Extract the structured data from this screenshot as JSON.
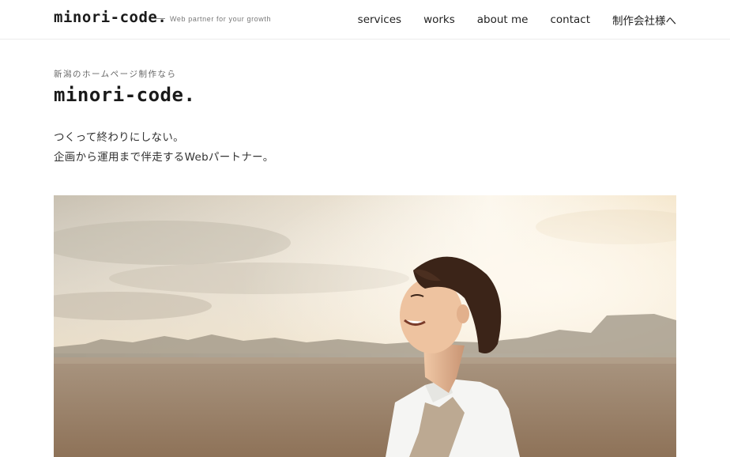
{
  "header": {
    "logo": "minori-code.",
    "tagline": "Web partner for your growth",
    "nav": [
      {
        "label": "services"
      },
      {
        "label": "works"
      },
      {
        "label": "about me"
      },
      {
        "label": "contact"
      },
      {
        "label": "制作会社様へ"
      }
    ]
  },
  "hero": {
    "eyebrow": "新潟のホームページ制作なら",
    "title": "minori-code.",
    "lead_line1": "つくって終わりにしない。",
    "lead_line2": "企画から運用まで伴走するWebパートナー。",
    "image_description_icon": "photo-woman-in-field-sunset"
  },
  "colors": {
    "text": "#222222",
    "muted": "#777777",
    "border": "#ececec",
    "sky_light": "#f7efe3",
    "field": "#b59a7e"
  }
}
